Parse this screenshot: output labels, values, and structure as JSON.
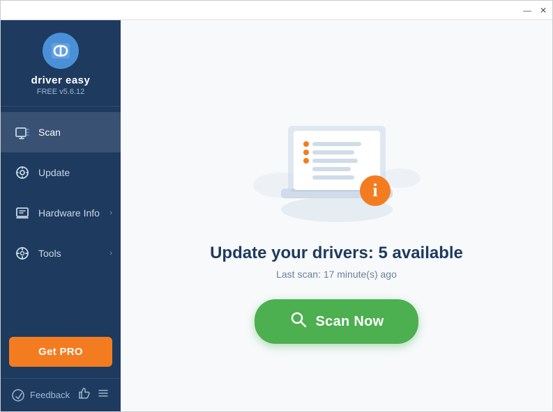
{
  "titlebar": {
    "minimize_label": "—",
    "close_label": "✕"
  },
  "sidebar": {
    "logo_text": "driver easy",
    "logo_version": "FREE v5.6.12",
    "nav_items": [
      {
        "id": "scan",
        "label": "Scan",
        "active": true,
        "has_chevron": false
      },
      {
        "id": "update",
        "label": "Update",
        "active": false,
        "has_chevron": false
      },
      {
        "id": "hardware-info",
        "label": "Hardware Info",
        "active": false,
        "has_chevron": true
      },
      {
        "id": "tools",
        "label": "Tools",
        "active": false,
        "has_chevron": true
      }
    ],
    "get_pro_label": "Get PRO",
    "feedback_label": "Feedback"
  },
  "main": {
    "headline": "Update your drivers: 5 available",
    "sub_headline": "Last scan: 17 minute(s) ago",
    "scan_button_label": "Scan Now"
  }
}
